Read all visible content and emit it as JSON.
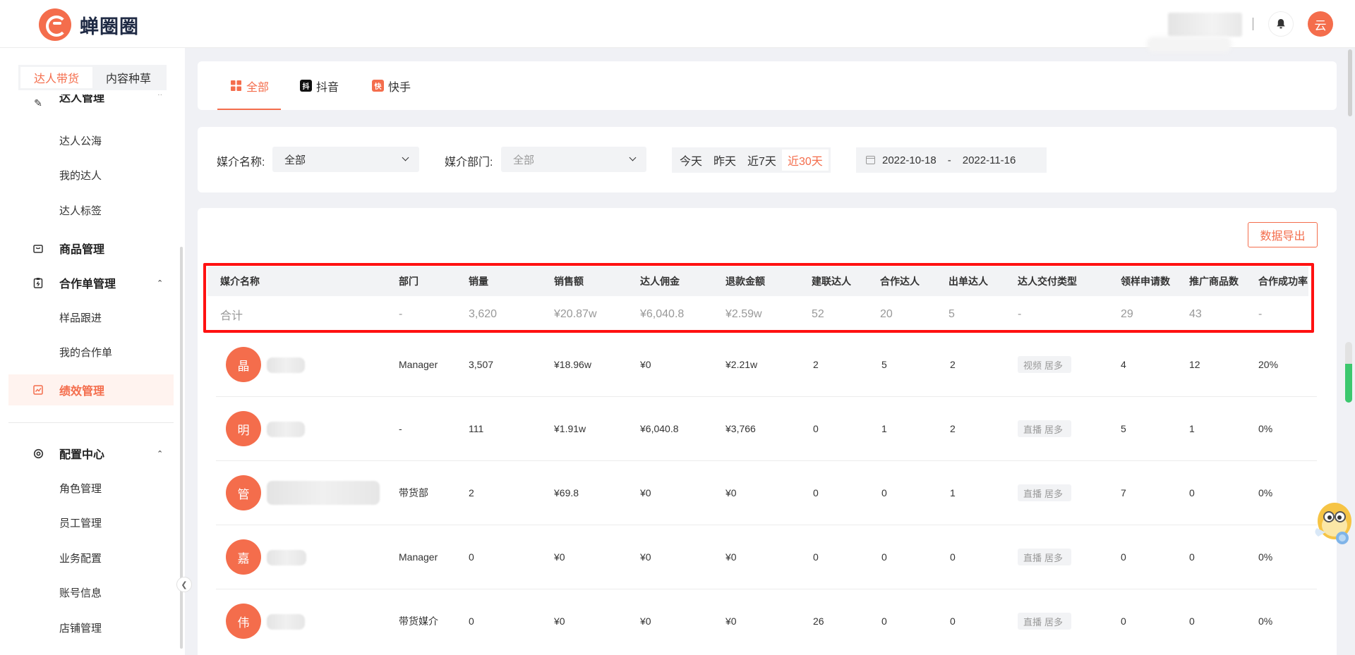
{
  "app": {
    "name": "蝉圈圈",
    "user_avatar_char": "云"
  },
  "sidebar": {
    "segments": [
      "达人带货",
      "内容种草"
    ],
    "active_segment": 0,
    "groups": [
      {
        "label": "达人管理",
        "icon": "pen-icon",
        "expanded": true,
        "items": [
          "达人公海",
          "我的达人",
          "达人标签"
        ]
      },
      {
        "label": "商品管理",
        "icon": "bag-icon",
        "expanded": false,
        "items": []
      },
      {
        "label": "合作单管理",
        "icon": "clipboard-icon",
        "expanded": true,
        "items": [
          "样品跟进",
          "我的合作单"
        ]
      },
      {
        "label": "绩效管理",
        "icon": "chart-icon",
        "active": true,
        "items": []
      },
      {
        "label": "配置中心",
        "icon": "gear-icon",
        "expanded": true,
        "items": [
          "角色管理",
          "员工管理",
          "业务配置",
          "账号信息",
          "店铺管理"
        ]
      }
    ]
  },
  "platform_tabs": [
    {
      "label": "全部",
      "icon": "grid-icon",
      "active": true
    },
    {
      "label": "抖音",
      "icon": "douyin-icon",
      "active": false
    },
    {
      "label": "快手",
      "icon": "kuaishou-icon",
      "active": false
    }
  ],
  "filters": {
    "media_name_label": "媒介名称:",
    "media_name_value": "全部",
    "media_dept_label": "媒介部门:",
    "media_dept_value": "全部",
    "ranges": [
      "今天",
      "昨天",
      "近7天",
      "近30天"
    ],
    "active_range": 3,
    "date_start": "2022-10-18",
    "date_sep": "-",
    "date_end": "2022-11-16"
  },
  "table": {
    "export_label": "数据导出",
    "columns": [
      "媒介名称",
      "部门",
      "销量",
      "销售额",
      "达人佣金",
      "退款金额",
      "建联达人",
      "合作达人",
      "出单达人",
      "达人交付类型",
      "领样申请数",
      "推广商品数",
      "合作成功率"
    ],
    "summary": [
      "合计",
      "-",
      "3,620",
      "¥20.87w",
      "¥6,040.8",
      "¥2.59w",
      "52",
      "20",
      "5",
      "-",
      "29",
      "43",
      "-"
    ],
    "rows": [
      {
        "avatar": "晶",
        "dept": "Manager",
        "sales": "3,507",
        "amount": "¥18.96w",
        "commission": "¥0",
        "refund": "¥2.21w",
        "contacted": "2",
        "cooperated": "5",
        "ordered": "2",
        "types": [
          "视频",
          "居多"
        ],
        "sample": "4",
        "products": "12",
        "rate": "20%"
      },
      {
        "avatar": "明",
        "dept": "-",
        "sales": "111",
        "amount": "¥1.91w",
        "commission": "¥6,040.8",
        "refund": "¥3,766",
        "contacted": "0",
        "cooperated": "1",
        "ordered": "2",
        "types": [
          "直播",
          "居多"
        ],
        "sample": "5",
        "products": "1",
        "rate": "0%"
      },
      {
        "avatar": "管",
        "dept": "带货部",
        "sales": "2",
        "amount": "¥69.8",
        "commission": "¥0",
        "refund": "¥0",
        "contacted": "0",
        "cooperated": "0",
        "ordered": "1",
        "types": [
          "直播",
          "居多"
        ],
        "sample": "7",
        "products": "0",
        "rate": "0%"
      },
      {
        "avatar": "嘉",
        "dept": "Manager",
        "sales": "0",
        "amount": "¥0",
        "commission": "¥0",
        "refund": "¥0",
        "contacted": "0",
        "cooperated": "0",
        "ordered": "0",
        "types": [
          "直播",
          "居多"
        ],
        "sample": "0",
        "products": "0",
        "rate": "0%"
      },
      {
        "avatar": "伟",
        "dept": "带货媒介",
        "sales": "0",
        "amount": "¥0",
        "commission": "¥0",
        "refund": "¥0",
        "contacted": "26",
        "cooperated": "0",
        "ordered": "0",
        "types": [
          "直播",
          "居多"
        ],
        "sample": "0",
        "products": "0",
        "rate": "0%"
      }
    ]
  },
  "colors": {
    "accent": "#f46d4c",
    "highlight_box": "#ff1111",
    "page_bg": "#f0f1f5"
  }
}
